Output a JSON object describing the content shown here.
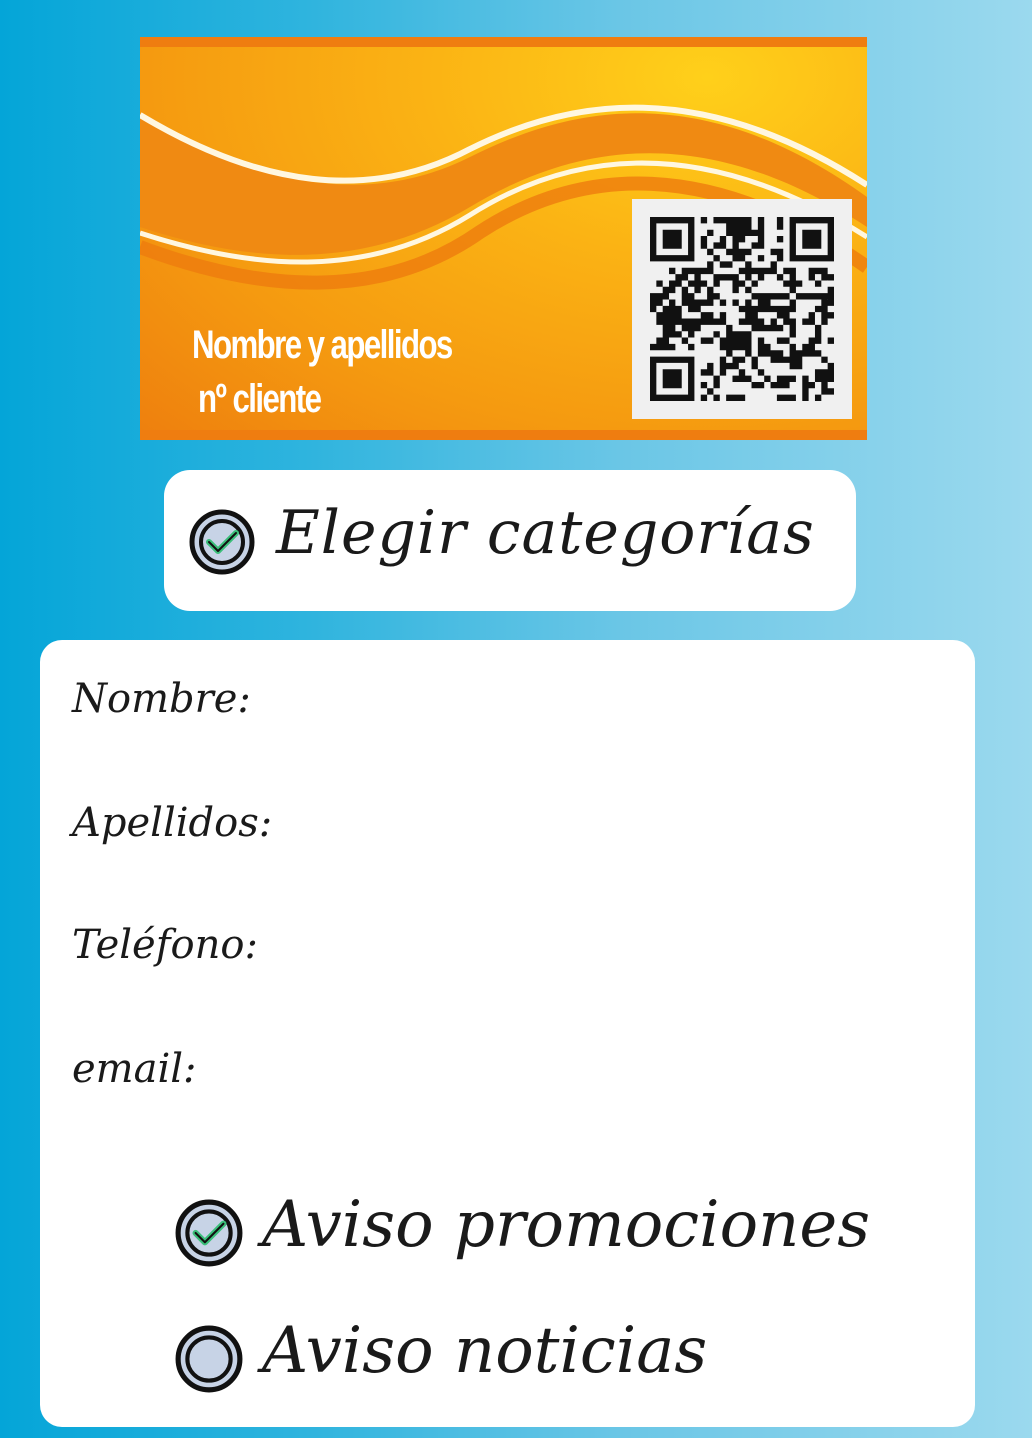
{
  "card": {
    "name_line": "Nombre y apellidos",
    "number_line": "nº cliente",
    "colors": {
      "orange": "#ef7d10",
      "yellow": "#ffd01a"
    },
    "qr_icon": "qr-code-icon"
  },
  "categories_button": {
    "label": "Elegir categorías",
    "icon": "check-circle-icon",
    "checked": true
  },
  "form": {
    "fields": [
      {
        "label": "Nombre:"
      },
      {
        "label": "Apellidos:"
      },
      {
        "label": "Teléfono:"
      },
      {
        "label": "email:"
      }
    ],
    "options": [
      {
        "label": "Aviso promociones",
        "checked": true,
        "icon": "check-circle-icon"
      },
      {
        "label": "Aviso noticias",
        "checked": false,
        "icon": "empty-circle-icon"
      }
    ]
  },
  "colors": {
    "background": "#04a5d8",
    "check_green": "#3bbf7a",
    "ring_fill": "#c7d3e6"
  }
}
